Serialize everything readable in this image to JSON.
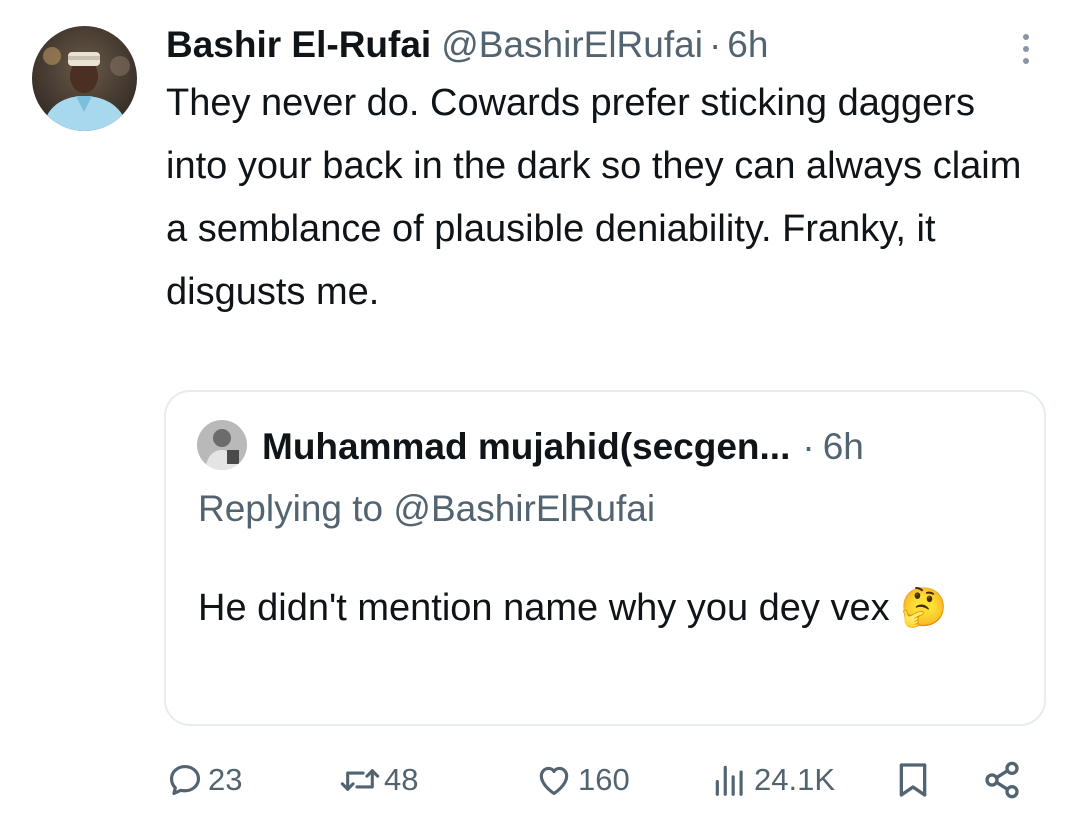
{
  "tweet": {
    "author": {
      "display_name": "Bashir El-Rufai",
      "handle": "@BashirElRufai",
      "separator": "·",
      "time": "6h"
    },
    "text": "They never do. Cowards prefer sticking daggers into your back in the dark so they can always claim a semblance of plausible deniability. Franky, it disgusts me."
  },
  "quote": {
    "author": {
      "display_name": "Muhammad mujahid(secgen...",
      "separator": "·",
      "time": "6h"
    },
    "replying_to": "Replying to @BashirElRufai",
    "text": "He didn't mention name why you dey vex 🤔"
  },
  "actions": {
    "replies": "23",
    "retweets": "48",
    "likes": "160",
    "views": "24.1K"
  },
  "icons": {
    "reply": "reply-icon",
    "retweet": "retweet-icon",
    "like": "heart-icon",
    "views": "views-icon",
    "bookmark": "bookmark-icon",
    "share": "share-icon",
    "more": "more-vertical-icon"
  },
  "colors": {
    "text": "#0f1419",
    "secondary": "#536471",
    "border": "#e6ecf0"
  }
}
